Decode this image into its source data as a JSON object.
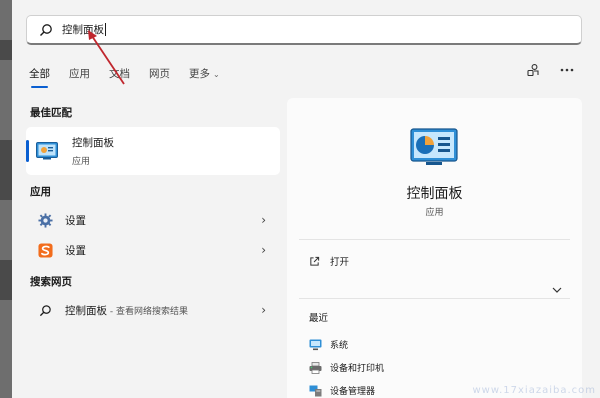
{
  "search": {
    "query": "控制面板"
  },
  "tabs": [
    {
      "label": "全部",
      "active": true
    },
    {
      "label": "应用"
    },
    {
      "label": "文档"
    },
    {
      "label": "网页"
    },
    {
      "label": "更多",
      "dropdown": true
    }
  ],
  "sections": {
    "best_match": "最佳匹配",
    "apps": "应用",
    "web_search": "搜索网页"
  },
  "best_match_item": {
    "name": "控制面板",
    "type": "应用"
  },
  "app_items": [
    {
      "label": "设置",
      "icon": "settings-gear-icon"
    },
    {
      "label": "设置",
      "icon": "sogou-s-icon"
    }
  ],
  "web_item": {
    "label": "控制面板",
    "suffix": " - 查看网络搜索结果"
  },
  "detail": {
    "title": "控制面板",
    "subtitle": "应用",
    "open_label": "打开",
    "recent_title": "最近",
    "recent": [
      {
        "label": "系统",
        "icon": "system-monitor-icon"
      },
      {
        "label": "设备和打印机",
        "icon": "printer-icon"
      },
      {
        "label": "设备管理器",
        "icon": "device-manager-icon"
      }
    ]
  },
  "watermark": "www.17xiazaiba.com",
  "colors": {
    "accent": "#0a5fd1",
    "annotation": "#c0262d"
  }
}
